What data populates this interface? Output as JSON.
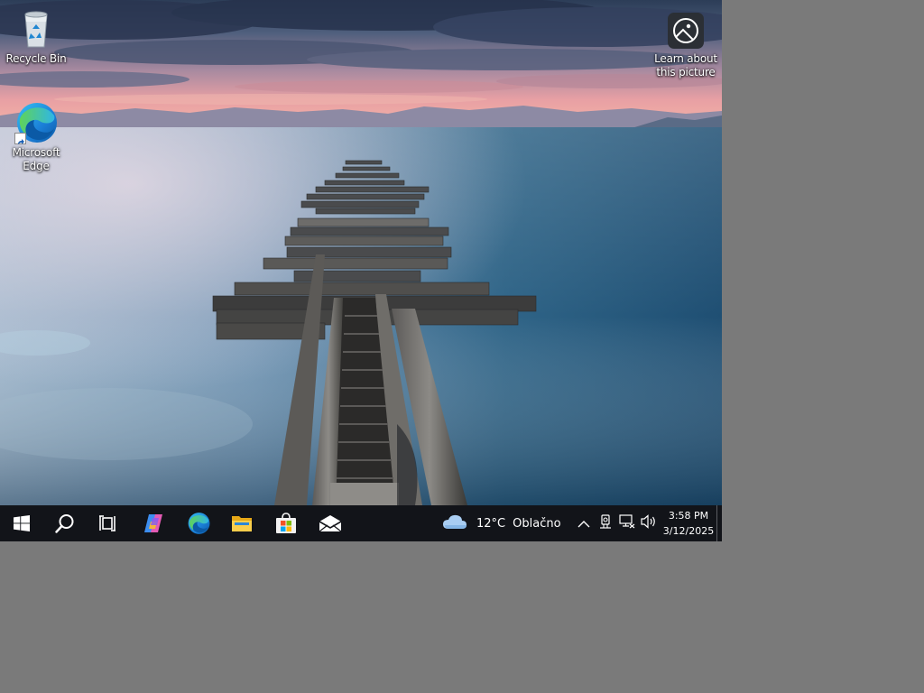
{
  "desktop": {
    "icons": [
      {
        "label": "Recycle Bin",
        "icon": "recycle-bin-icon"
      },
      {
        "label": "Microsoft Edge",
        "icon": "edge-icon"
      },
      {
        "label": "Learn about this picture",
        "icon": "learn-picture-icon"
      }
    ]
  },
  "taskbar": {
    "start": {
      "icon": "windows-logo-icon"
    },
    "search": {
      "icon": "search-icon"
    },
    "task_view": {
      "icon": "task-view-icon"
    },
    "pinned": [
      {
        "name": "Copilot",
        "icon": "copilot-icon"
      },
      {
        "name": "Microsoft Edge",
        "icon": "edge-icon"
      },
      {
        "name": "File Explorer",
        "icon": "folder-icon"
      },
      {
        "name": "Microsoft Store",
        "icon": "store-icon"
      },
      {
        "name": "Mail",
        "icon": "mail-icon"
      }
    ],
    "weather": {
      "temperature": "12°C",
      "condition": "Oblačno",
      "icon": "cloud-icon"
    },
    "tray": [
      "chevron-up-icon",
      "location-icon",
      "network-icon",
      "volume-icon"
    ],
    "clock": {
      "time": "3:58 PM",
      "date": "3/12/2025"
    }
  },
  "colors": {
    "taskbar_bg": "#121419",
    "outside_screen": "#7a7a7a"
  }
}
